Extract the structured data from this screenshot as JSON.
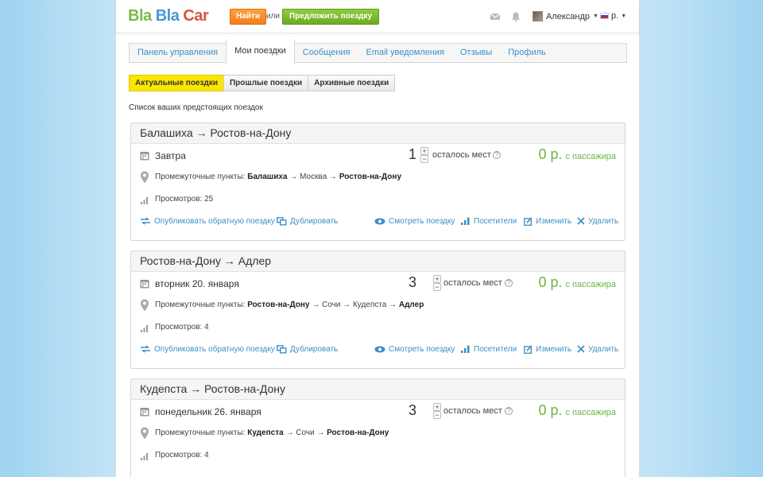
{
  "header": {
    "logo": {
      "part1": "Bla",
      "part2": "Bla",
      "part3": "Car"
    },
    "find_button": "Найти",
    "or_text": "или",
    "offer_button": "Предложить поездку",
    "user_name": "Александр",
    "currency": "р."
  },
  "tabs": [
    {
      "label": "Панель управления"
    },
    {
      "label": "Мои поездки"
    },
    {
      "label": "Сообщения"
    },
    {
      "label": "Email уведомления"
    },
    {
      "label": "Отзывы"
    },
    {
      "label": "Профиль"
    }
  ],
  "subtabs": [
    {
      "label": "Актуальные поездки"
    },
    {
      "label": "Прошлые поездки"
    },
    {
      "label": "Архивные поездки"
    }
  ],
  "list_caption": "Список ваших предстоящих поездок",
  "labels": {
    "seats_left": "осталось мест",
    "per_passenger": "с пассажира",
    "waypoints_prefix": "Промежуточные пункты:",
    "views_prefix": "Просмотров:",
    "publish_return": "Опубликовать обратную поездку",
    "duplicate": "Дублировать",
    "view_trip": "Смотреть поездку",
    "visitors": "Посетители",
    "edit": "Изменить",
    "delete": "Удалить",
    "arrow": "→"
  },
  "trips": [
    {
      "title": "Балашиха → Ростов-на-Дону",
      "date": "Завтра",
      "seats": "1",
      "price": "0 р.",
      "route": {
        "from": "Балашиха",
        "mid": "Москва",
        "to": "Ростов-на-Дону"
      },
      "views": "25"
    },
    {
      "title": "Ростов-на-Дону → Адлер",
      "date": "вторник 20. января",
      "seats": "3",
      "price": "0 р.",
      "route": {
        "from": "Ростов-на-Дону",
        "mid": "Сочи → Кудепста",
        "to": "Адлер"
      },
      "views": "4"
    },
    {
      "title": "Кудепста → Ростов-на-Дону",
      "date": "понедельник 26. января",
      "seats": "3",
      "price": "0 р.",
      "route": {
        "from": "Кудепста",
        "mid": "Сочи",
        "to": "Ростов-на-Дону"
      },
      "views": "4"
    }
  ]
}
